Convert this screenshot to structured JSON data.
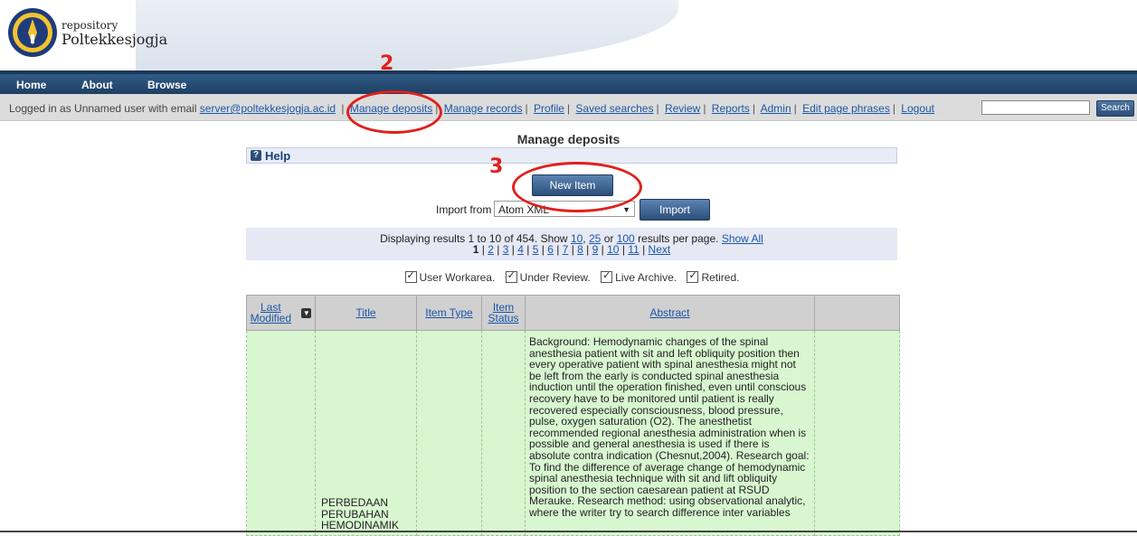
{
  "header": {
    "logo_text_small": "repository",
    "logo_text_big": "Poltekkesjogja"
  },
  "nav": {
    "home": "Home",
    "about": "About",
    "browse": "Browse"
  },
  "userbar": {
    "logged_in_text": "Logged in as Unnamed user with email",
    "email": "server@poltekkesjogja.ac.id",
    "links": [
      "Manage deposits",
      "Manage records",
      "Profile",
      "Saved searches",
      "Review",
      "Reports",
      "Admin",
      "Edit page phrases",
      "Logout"
    ],
    "search_button": "Search",
    "search_value": ""
  },
  "page": {
    "title": "Manage deposits",
    "help_label": "Help",
    "new_item": "New Item",
    "import_label": "Import from",
    "import_selected": "Atom XML",
    "import_button": "Import"
  },
  "paging": {
    "line1_prefix": "Displaying results 1 to 10 of 454. Show",
    "opt10": "10",
    "comma": ",",
    "opt25": "25",
    "or": "or",
    "opt100": "100",
    "suffix": "results per page.",
    "show_all": "Show All",
    "current": "1",
    "pages": [
      "2",
      "3",
      "4",
      "5",
      "6",
      "7",
      "8",
      "9",
      "10",
      "11"
    ],
    "next": "Next"
  },
  "filters": {
    "user_workarea": "User Workarea.",
    "under_review": "Under Review.",
    "live_archive": "Live Archive.",
    "retired": "Retired."
  },
  "table": {
    "headers": {
      "last_modified_1": "Last",
      "last_modified_2": "Modified",
      "title": "Title",
      "item_type": "Item Type",
      "item_status_1": "Item",
      "item_status_2": "Status",
      "abstract": "Abstract"
    },
    "row1": {
      "title": "PERBEDAAN PERUBAHAN HEMODINAMIK",
      "abstract": "Background: Hemodynamic changes of the spinal anesthesia patient with sit and left obliquity position then every operative patient with spinal anesthesia might not be left from the early is conducted spinal anesthesia induction until the operation finished, even until conscious recovery have to be monitored until patient is really recovered especially consciousness, blood pressure, pulse, oxygen saturation (O2). The anesthetist recommended regional anesthesia administration when is possible and general anesthesia is used if there is absolute contra indication (Chesnut,2004). Research goal: To find the difference of average change of hemodynamic spinal anesthesia technique with sit and lift obliquity position to the section caesarean patient at RSUD Merauke. Research method: using observational analytic, where the writer try to search difference inter variables"
    }
  },
  "annotations": {
    "step2": "2",
    "step3": "3"
  },
  "colors": {
    "nav_bg": "#1e3f63",
    "link": "#1c56a8",
    "row_bg": "#d8f7d0",
    "annotation": "#e0201c"
  }
}
